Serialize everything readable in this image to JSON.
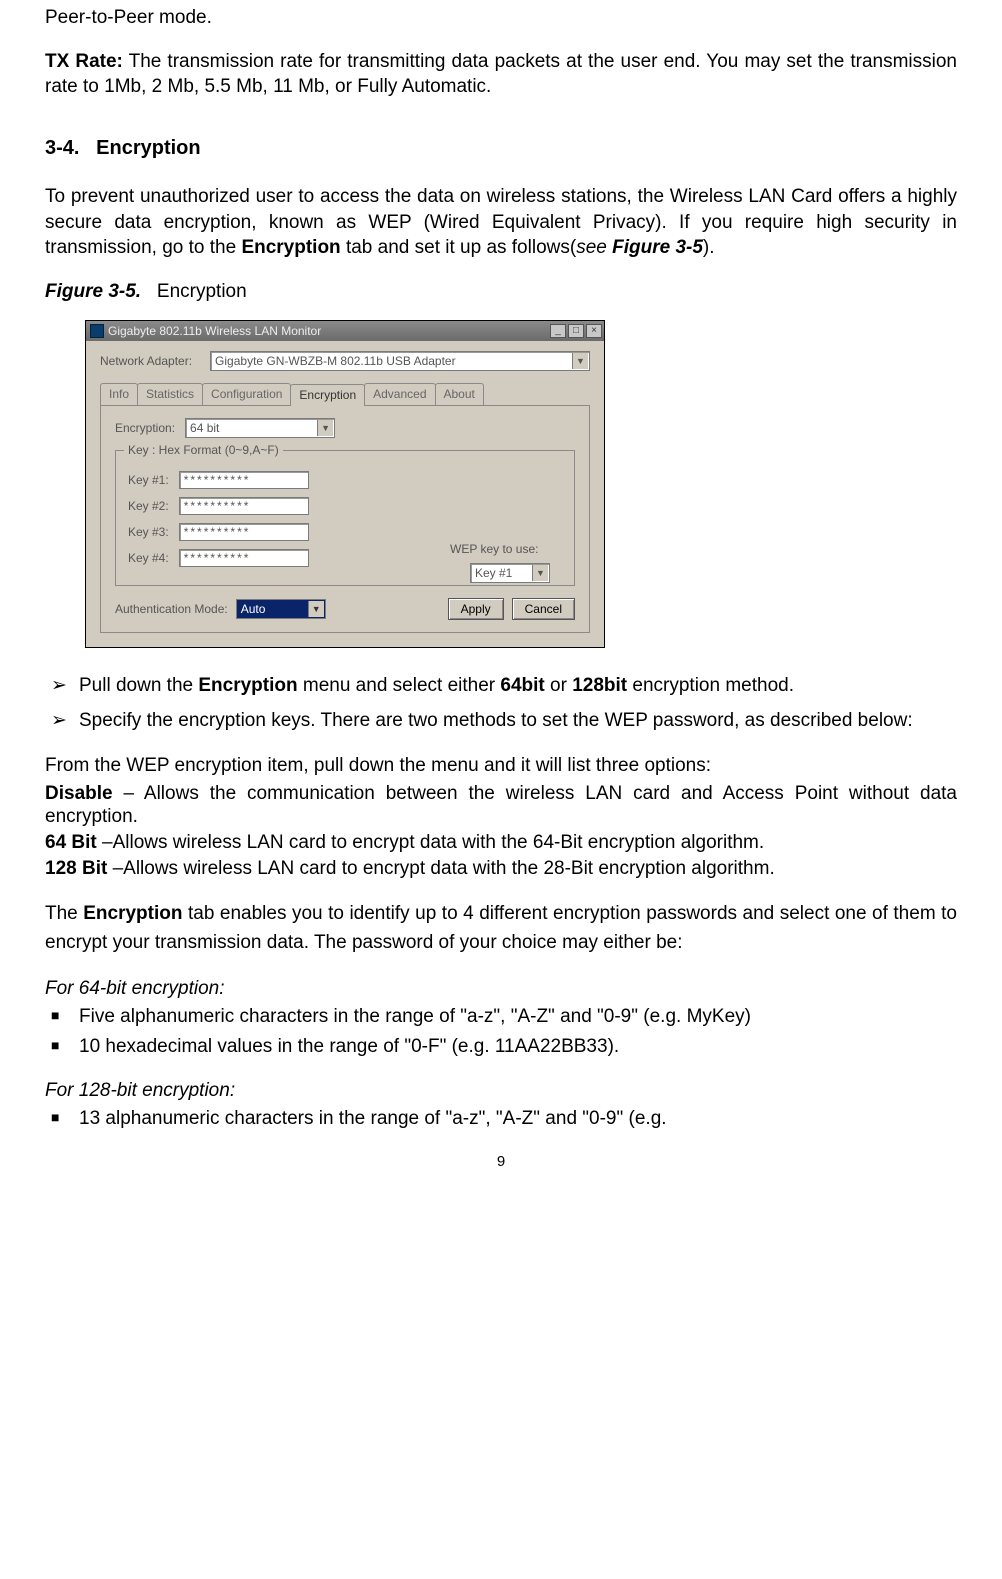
{
  "intro_para": "Peer-to-Peer mode.",
  "tx_rate": {
    "label": "TX Rate:",
    "text": " The transmission rate for transmitting data packets at the user end. You may set the transmission rate to 1Mb, 2 Mb, 5.5 Mb, 11 Mb, or Fully Automatic."
  },
  "section": {
    "number": "3-4.",
    "title": "Encryption"
  },
  "enc_para_1a": "To prevent unauthorized user to access the data on wireless stations, the Wireless LAN Card offers a highly secure data encryption, known as WEP (Wired Equivalent Privacy). If you require high security in transmission, go to the ",
  "enc_para_1b": "Encryption",
  "enc_para_1c": " tab and set it up as follows(",
  "enc_para_1d": "see ",
  "enc_para_1e": "Figure 3-5",
  "enc_para_1f": ").",
  "figure": {
    "num": "Figure 3-5.",
    "caption": "Encryption"
  },
  "dialog": {
    "title": "Gigabyte 802.11b Wireless LAN Monitor",
    "adapter_label": "Network Adapter:",
    "adapter_value": "Gigabyte GN-WBZB-M 802.11b USB Adapter",
    "tabs": [
      "Info",
      "Statistics",
      "Configuration",
      "Encryption",
      "Advanced",
      "About"
    ],
    "encryption_label": "Encryption:",
    "encryption_value": "64 bit",
    "key_group_label": "Key :  Hex Format (0~9,A~F)",
    "keys": [
      {
        "label": "Key #1:",
        "value": "**********"
      },
      {
        "label": "Key #2:",
        "value": "**********"
      },
      {
        "label": "Key #3:",
        "value": "**********"
      },
      {
        "label": "Key #4:",
        "value": "**********"
      }
    ],
    "wep_use_label": "WEP key to use:",
    "wep_use_value": "Key #1",
    "auth_label": "Authentication Mode:",
    "auth_value": "Auto",
    "apply": "Apply",
    "cancel": "Cancel"
  },
  "arrow_items": {
    "a_pre": "Pull down the ",
    "a_b1": "Encryption",
    "a_mid": " menu and select either ",
    "a_b2": "64bit",
    "a_or": " or ",
    "a_b3": "128bit",
    "a_post": " encryption method.",
    "b": "Specify the encryption keys.  There are two methods to set the WEP password, as described below:"
  },
  "wep_menu_intro": "From the WEP encryption item, pull down the menu and it will list three options:",
  "disable": {
    "label": "Disable",
    "text": " – Allows the communication between the wireless LAN card and Access Point without data encryption."
  },
  "b64": {
    "label": "64 Bit",
    "text": " –Allows wireless LAN card to encrypt data with the 64-Bit encryption algorithm."
  },
  "b128": {
    "label": "128 Bit",
    "text": " –Allows wireless LAN card to encrypt data with the 28-Bit encryption algorithm."
  },
  "enc_tab_para_a": "The ",
  "enc_tab_para_b": "Encryption",
  "enc_tab_para_c": " tab enables you to identify up to 4 different encryption passwords and select one of them to encrypt your transmission data.  The password of your choice may either be:",
  "for64_heading": "For 64-bit encryption:",
  "for64_item1": "Five alphanumeric characters in the range of \"a-z\", \"A-Z\" and \"0-9\" (e.g. MyKey)",
  "for64_item2": "10 hexadecimal values in the range of \"0-F\" (e.g. 11AA22BB33).",
  "for128_heading": "For 128-bit encryption:",
  "for128_item1": "13  alphanumeric  characters  in  the  range  of  \"a-z\",  \"A-Z\"  and  \"0-9\"  (e.g.",
  "page_number": "9"
}
